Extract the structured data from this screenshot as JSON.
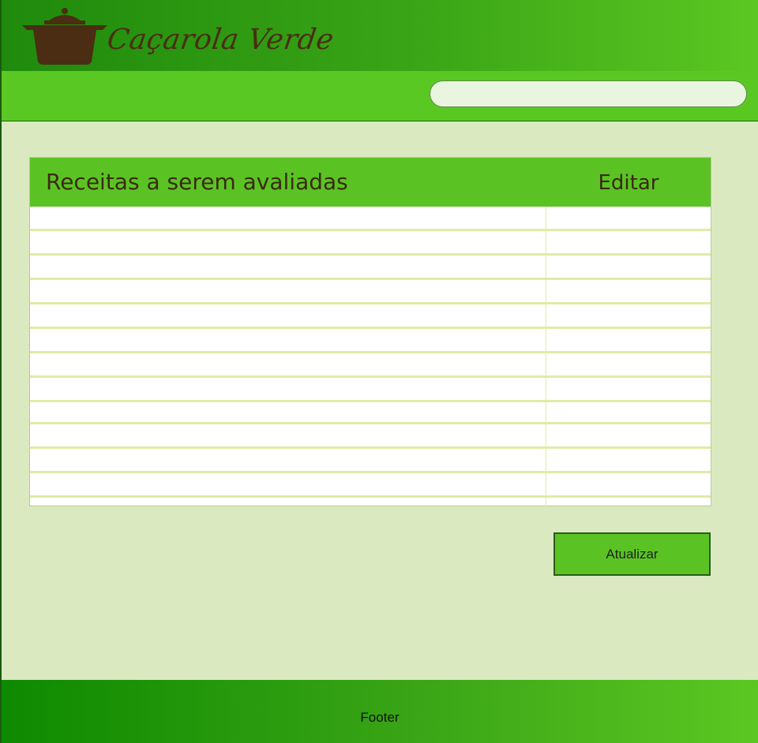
{
  "brand": {
    "name": "Caçarola Verde",
    "logo_icon": "cooking-pot-icon"
  },
  "search": {
    "value": "",
    "placeholder": ""
  },
  "table": {
    "header_recipes": "Receitas a serem avaliadas",
    "header_edit": "Editar",
    "rows": [
      "",
      "",
      "",
      "",
      "",
      "",
      "",
      "",
      "",
      "",
      "",
      ""
    ]
  },
  "actions": {
    "update_label": "Atualizar"
  },
  "footer": {
    "text": "Footer"
  },
  "colors": {
    "header_green": "#3aa516",
    "nav_green": "#5ac823",
    "page_bg": "#dbe9c1",
    "pot_brown": "#4a2d12"
  }
}
